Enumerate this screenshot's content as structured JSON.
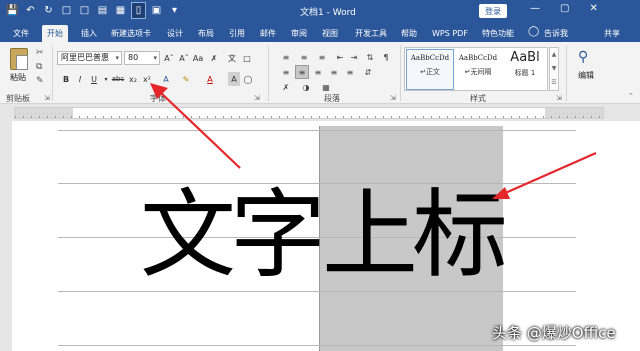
{
  "titlebar": {
    "document_title": "文档1 - Word",
    "login_label": "登录",
    "window_controls": [
      "—",
      "▢",
      "✕"
    ],
    "qat_icons": [
      "save-icon",
      "undo-icon",
      "redo-icon",
      "new-doc-icon",
      "open-folder-icon",
      "print-preview-icon",
      "save-as-icon",
      "page-layout-icon",
      "view-icon",
      "customize-icon"
    ]
  },
  "tabs": [
    {
      "label": "文件"
    },
    {
      "label": "开始"
    },
    {
      "label": "插入"
    },
    {
      "label": "新建选项卡"
    },
    {
      "label": "设计"
    },
    {
      "label": "布局"
    },
    {
      "label": "引用"
    },
    {
      "label": "邮件"
    },
    {
      "label": "审阅"
    },
    {
      "label": "视图"
    },
    {
      "label": "开发工具"
    },
    {
      "label": "帮助"
    },
    {
      "label": "WPS PDF"
    },
    {
      "label": "特色功能"
    }
  ],
  "active_tab": "开始",
  "tell_me": "告诉我",
  "share": "共享",
  "ribbon": {
    "clipboard": {
      "paste_label": "粘贴",
      "group_label": "剪贴板"
    },
    "font": {
      "font_name": "阿里巴巴普惠",
      "font_size": "80",
      "group_label": "字体",
      "buttons": [
        "B",
        "I",
        "U",
        "abc",
        "x₂",
        "x²"
      ]
    },
    "paragraph": {
      "group_label": "段落"
    },
    "styles": {
      "group_label": "样式",
      "items": [
        {
          "sample": "AaBbCcDd",
          "name": "正文"
        },
        {
          "sample": "AaBbCcDd",
          "name": "无间隔"
        },
        {
          "sample": "AaBl",
          "name": "标题 1"
        }
      ]
    },
    "editing": {
      "label": "编辑"
    }
  },
  "document": {
    "plain_text": "文字",
    "superscript_text": "上标"
  },
  "watermark": "头条 @爆炒Office",
  "colors": {
    "word_blue": "#2b579a",
    "ribbon_bg": "#f3f3f3",
    "highlight": "#c8c8c8",
    "arrow": "#e5262a"
  }
}
